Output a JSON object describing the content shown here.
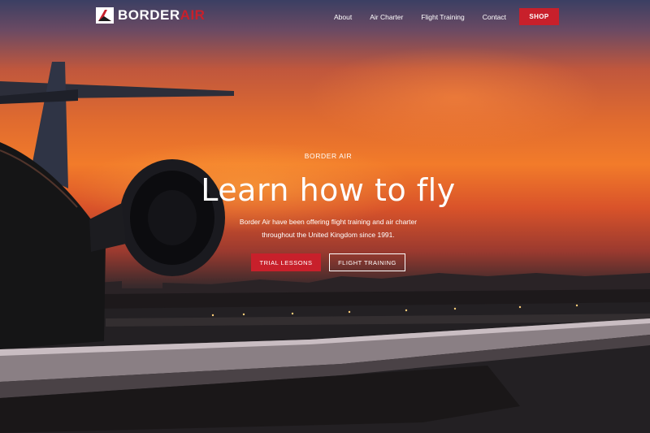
{
  "brand": {
    "name_part1": "BORDER",
    "name_part2": "AIR",
    "accent_color": "#c8202b",
    "logo_icon": "plane-tail-icon"
  },
  "nav": {
    "items": [
      {
        "label": "About"
      },
      {
        "label": "Air Charter"
      },
      {
        "label": "Flight Training"
      },
      {
        "label": "Contact"
      }
    ],
    "shop_label": "SHOP"
  },
  "hero": {
    "eyebrow": "BORDER AIR",
    "headline": "Learn how to fly",
    "description_line1": "Border Air have been offering flight training and air charter",
    "description_line2": "throughout the United Kingdom since 1991.",
    "primary_cta": "TRIAL LESSONS",
    "secondary_cta": "FLIGHT TRAINING"
  }
}
